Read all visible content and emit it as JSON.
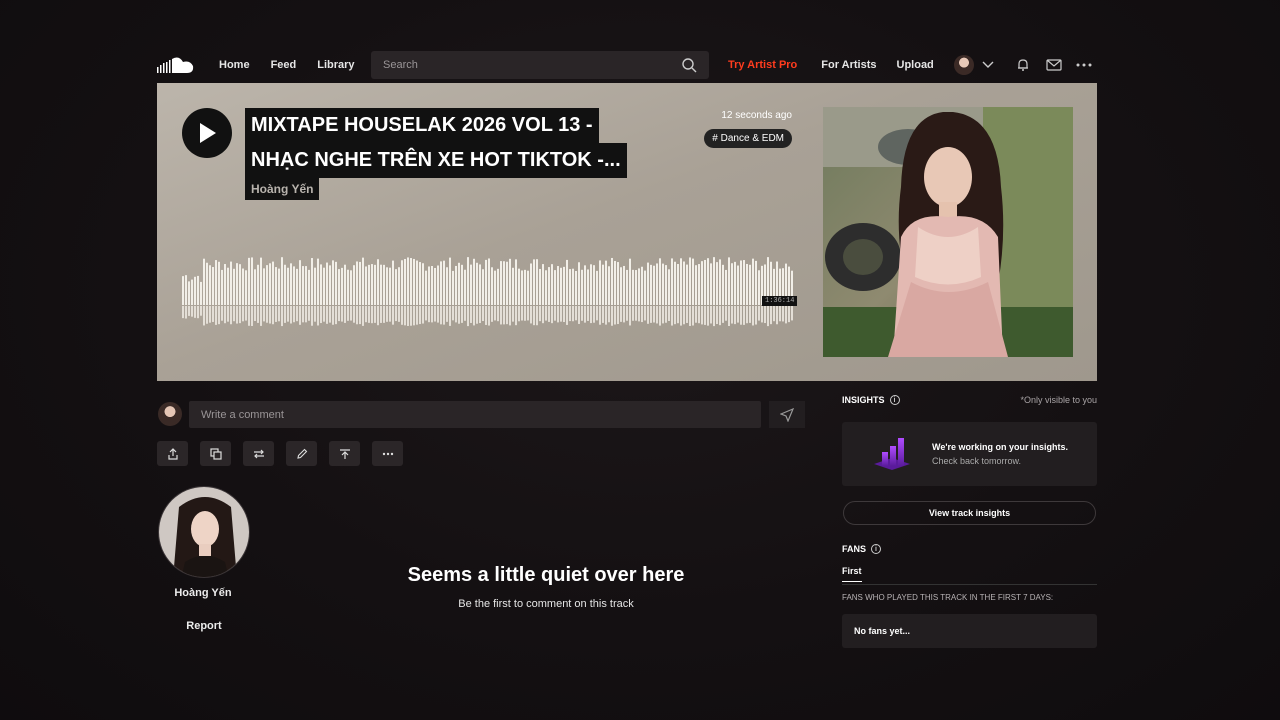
{
  "header": {
    "nav": [
      "Home",
      "Feed",
      "Library"
    ],
    "search_placeholder": "Search",
    "try_pro": "Try Artist Pro",
    "for_artists": "For Artists",
    "upload": "Upload",
    "brand_color": "#ff3c1e"
  },
  "track": {
    "title_line1": "MIXTAPE HOUSELAK 2026 VOL 13 -",
    "title_line2": "NHẠC NGHE TRÊN XE HOT TIKTOK -...",
    "artist": "Hoàng Yến",
    "posted": "12 seconds ago",
    "genre": "# Dance & EDM",
    "duration": "1:36:14"
  },
  "comment": {
    "placeholder": "Write a comment"
  },
  "actions": [
    "share-icon",
    "copy-link-icon",
    "repost-icon",
    "edit-icon",
    "more-options-icon"
  ],
  "artist_card": {
    "name": "Hoàng Yến",
    "report": "Report"
  },
  "empty_state": {
    "title": "Seems a little quiet over here",
    "subtitle": "Be the first to comment on this track"
  },
  "insights": {
    "title": "INSIGHTS",
    "visibility": "*Only visible to you",
    "card_title": "We're working on your insights.",
    "card_sub": "Check back tomorrow.",
    "button": "View track insights",
    "accent": "#8a2be2"
  },
  "fans": {
    "title": "FANS",
    "tab": "First",
    "description": "FANS WHO PLAYED THIS TRACK IN THE FIRST 7 DAYS:",
    "empty": "No fans yet..."
  }
}
